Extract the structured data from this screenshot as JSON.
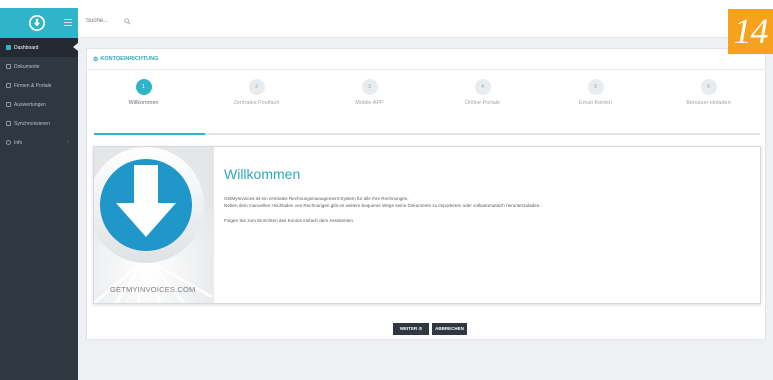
{
  "sidebar": {
    "items": [
      {
        "label": "Dashboard",
        "icon": "dashboard-icon",
        "active": true
      },
      {
        "label": "Dokumente",
        "icon": "document-icon"
      },
      {
        "label": "Firmen & Portale",
        "icon": "building-icon"
      },
      {
        "label": "Auswertungen",
        "icon": "chart-icon"
      },
      {
        "label": "Synchronisieren",
        "icon": "sync-icon"
      },
      {
        "label": "Info",
        "icon": "info-icon",
        "has_submenu": true
      }
    ]
  },
  "topbar": {
    "search_placeholder": "Suche..."
  },
  "badge": {
    "text": "14",
    "color": "#f6a21d"
  },
  "card": {
    "title": "KONTOEINRICHTUNG"
  },
  "steps": [
    {
      "number": "1",
      "label": "Willkommen",
      "active": true
    },
    {
      "number": "2",
      "label": "Zentrales Postfach"
    },
    {
      "number": "3",
      "label": "Mobile APP"
    },
    {
      "number": "4",
      "label": "Online-Portale"
    },
    {
      "number": "5",
      "label": "Email-Konten"
    },
    {
      "number": "6",
      "label": "Benutzer einladen"
    }
  ],
  "progress": {
    "fraction": 0.1667
  },
  "welcome": {
    "title": "Willkommen",
    "line1": "GetMyInvoices ist ein zentrales Rechnungsmanagement-System für alle Ihre Rechnungen.",
    "line2": "Neben dem manuellen Hochladen von Rechnungen gibt es weitere bequeme Wege seine Dokumente zu importieren oder vollautomatisch herunterzuladen.",
    "line3": "Folgen Sie zum Einrichten des Kontos einfach dem Assistenten.",
    "hero_caption": "GETMYINVOICES.COM"
  },
  "buttons": {
    "next": "WEITER ⊙",
    "cancel": "ABBRECHEN"
  },
  "colors": {
    "accent": "#2fb4c9",
    "sidebar": "#2f3740",
    "badge": "#f6a21d"
  }
}
